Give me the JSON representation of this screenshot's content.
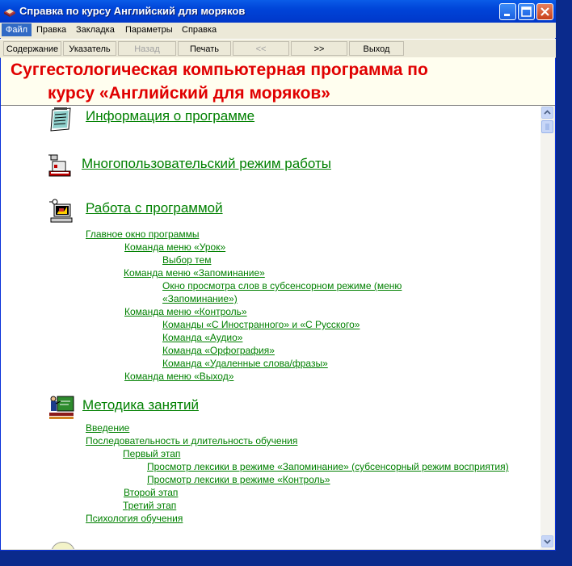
{
  "window": {
    "title": "Справка по курсу Английский для моряков"
  },
  "menu": [
    "Файл",
    "Правка",
    "Закладка",
    "Параметры",
    "Справка"
  ],
  "toolbar": {
    "contents": "Содержание",
    "index": "Указатель",
    "back": "Назад",
    "print": "Печать",
    "prev": "<<",
    "next": ">>",
    "exit": "Выход"
  },
  "banner": {
    "line1": "Суггестологическая компьютерная программа по",
    "line2": "курсу «Английский для моряков»",
    "color": "#e00000"
  },
  "sections": {
    "info": "Информация о программе",
    "multiuser": "Многопользовательский режим работы",
    "work": "Работа с программой",
    "method": "Методика занятий"
  },
  "work_links": [
    "Главное окно программы",
    "Команда меню «Урок»",
    "Выбор тем",
    "Команда меню «Запоминание»",
    "Окно просмотра слов в субсенсорном режиме (меню",
    "«Запоминание»)",
    "Команда меню «Контроль»",
    "Команды «С Иностранного» и «С Русского»",
    "Команда «Аудио»",
    "Команда «Орфография»",
    "Команда «Удаленные слова/фразы»",
    "Команда меню «Выход»"
  ],
  "method_links": [
    "Введение",
    "Последовательность и длительность обучения",
    "Первый этап",
    "Просмотр лексики в режиме «Запоминание» (субсенсорный режим восприятия)",
    "Просмотр лексики в режиме «Контроль»",
    "Второй этап",
    "Третий этап",
    "Психология обучения"
  ],
  "colors": {
    "link": "#008000",
    "titlebar": "#0044d8",
    "desktop": "#0a2a8c"
  },
  "icons": [
    "book-icon",
    "minimize-icon",
    "maximize-icon",
    "close-icon",
    "notepad-icon",
    "network-icon",
    "computer-icon",
    "teacher-icon",
    "arrow-up-icon",
    "arrow-down-icon"
  ]
}
